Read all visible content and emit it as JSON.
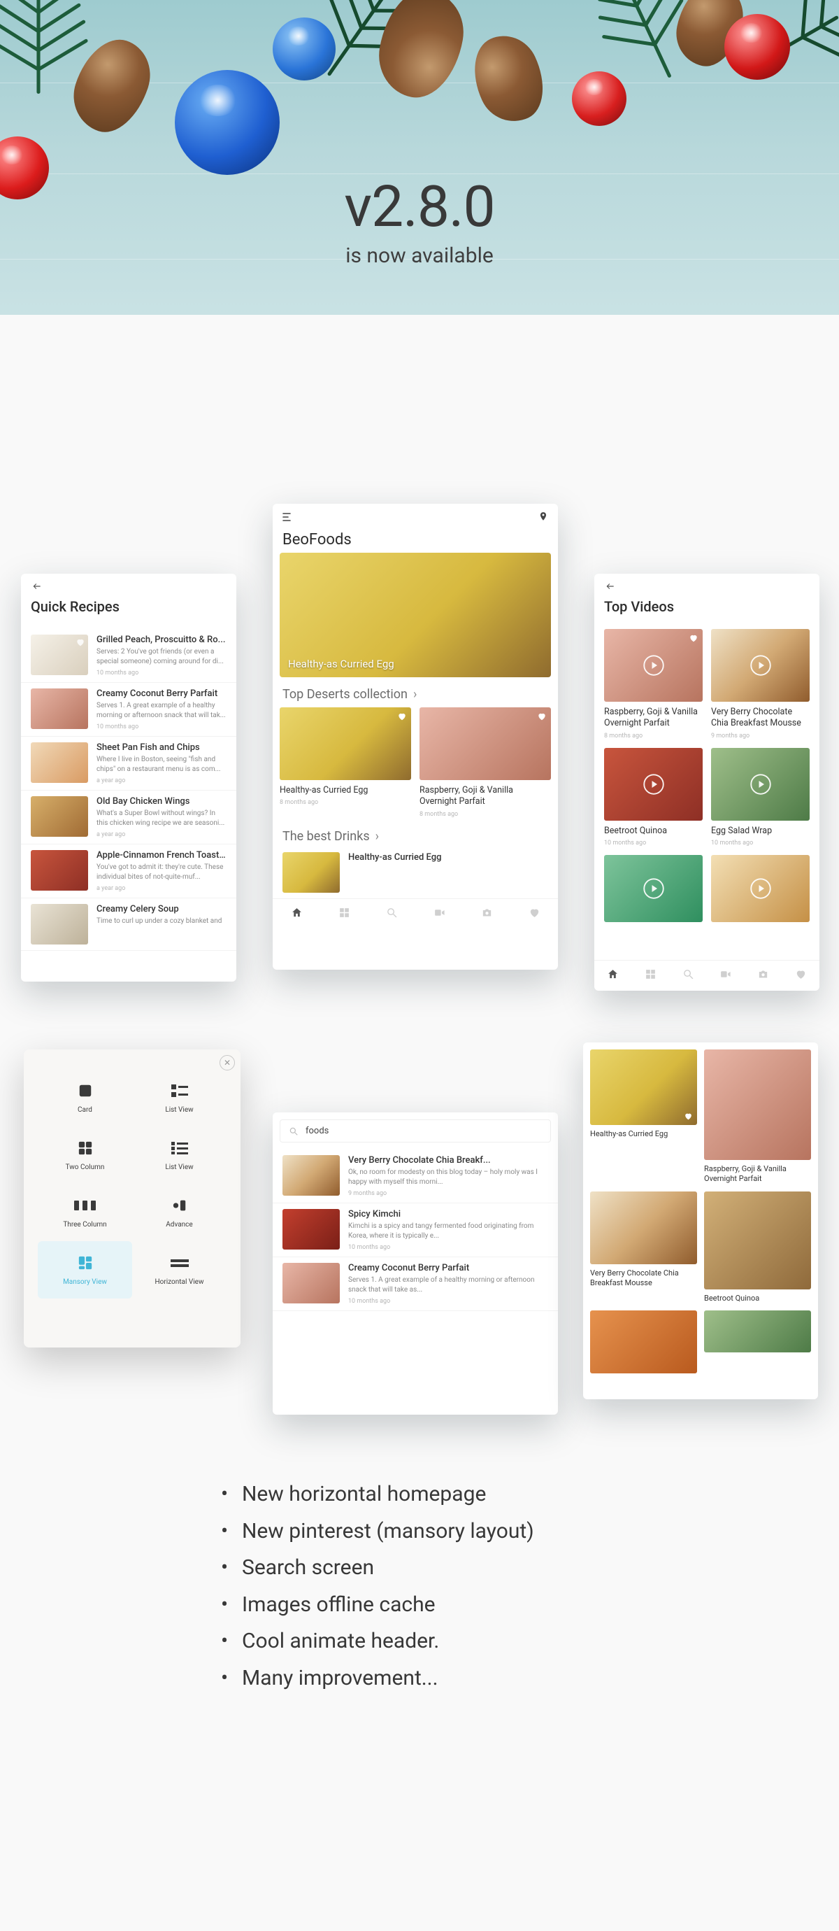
{
  "hero": {
    "version": "v2.8.0",
    "subtitle": "is now available"
  },
  "phone_center": {
    "app_name": "BeoFoods",
    "featured_title": "Healthy-as Curried Egg",
    "section1": "Top Deserts collection",
    "cards1": [
      {
        "title": "Healthy-as Curried Egg",
        "meta": "8 months ago"
      },
      {
        "title": "Raspberry, Goji & Vanilla Overnight Parfait",
        "meta": "8 months ago"
      }
    ],
    "section2": "The best Drinks",
    "small_row_title": "Healthy-as Curried Egg"
  },
  "phone_left": {
    "title": "Quick Recipes",
    "items": [
      {
        "title": "Grilled Peach, Proscuitto & Ro...",
        "desc": "Serves: 2 You've got friends (or even a special someone) coming around for di...",
        "meta": "10 months ago"
      },
      {
        "title": "Creamy Coconut Berry Parfait",
        "desc": "Serves 1. A great example of a healthy morning or afternoon snack that will tak...",
        "meta": "10 months ago"
      },
      {
        "title": "Sheet Pan Fish and Chips",
        "desc": "Where I live in Boston, seeing \"fish and chips\" on a restaurant menu is as com...",
        "meta": "a year ago"
      },
      {
        "title": "Old Bay Chicken Wings",
        "desc": "What's a Super Bowl without wings? In this chicken wing recipe we are seasoni...",
        "meta": "a year ago"
      },
      {
        "title": "Apple-Cinnamon French Toast...",
        "desc": "You've got to admit it: they're cute. These individual bites of not-quite-muf...",
        "meta": "a year ago"
      },
      {
        "title": "Creamy Celery Soup",
        "desc": "Time to curl up under a cozy blanket and",
        "meta": ""
      }
    ]
  },
  "phone_right": {
    "title": "Top Videos",
    "row1": [
      {
        "title": "Raspberry, Goji & Vanilla Overnight Parfait",
        "meta": "8 months ago"
      },
      {
        "title": "Very Berry Chocolate Chia Breakfast Mousse",
        "meta": "9 months ago"
      }
    ],
    "row2": [
      {
        "title": "Beetroot Quinoa",
        "meta": "10 months ago"
      },
      {
        "title": "Egg Salad Wrap",
        "meta": "10 months ago"
      }
    ]
  },
  "layout_modal": {
    "opts": [
      {
        "label": "Card"
      },
      {
        "label": "List View"
      },
      {
        "label": "Two Column"
      },
      {
        "label": "List View"
      },
      {
        "label": "Three Column"
      },
      {
        "label": "Advance"
      },
      {
        "label": "Mansory View",
        "selected": true
      },
      {
        "label": "Horizontal View"
      }
    ]
  },
  "phone_search": {
    "query": "foods",
    "items": [
      {
        "title": "Very Berry Chocolate Chia Breakf...",
        "desc": "Ok, no room for modesty on this blog today – holy moly was I happy with myself this morni...",
        "meta": "9 months ago"
      },
      {
        "title": "Spicy Kimchi",
        "desc": "Kimchi is a spicy and tangy fermented food originating from Korea, where it is typically e...",
        "meta": "10 months ago"
      },
      {
        "title": "Creamy Coconut Berry Parfait",
        "desc": "Serves 1. A great example of a healthy morning or afternoon snack that will take as...",
        "meta": "10 months ago"
      }
    ]
  },
  "phone_masonry": {
    "items": [
      {
        "title": "Healthy-as Curried Egg"
      },
      {
        "title": "Raspberry, Goji & Vanilla Overnight Parfait"
      },
      {
        "title": "Very Berry Chocolate Chia Breakfast Mousse"
      },
      {
        "title": "Beetroot Quinoa"
      }
    ]
  },
  "features": [
    "New horizontal homepage",
    "New pinterest (mansory layout)",
    "Search screen",
    "Images offline cache",
    "Cool animate header.",
    "Many improvement..."
  ]
}
